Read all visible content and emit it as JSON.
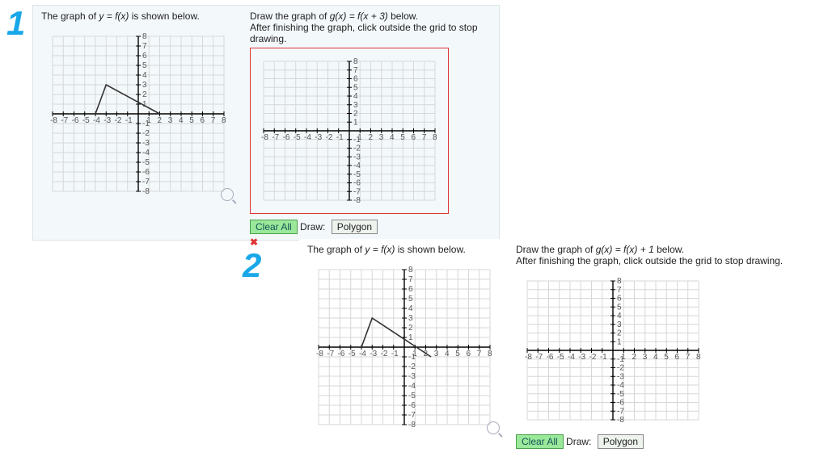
{
  "numbers": {
    "one": "1",
    "two": "2"
  },
  "p1": {
    "left_prompt_pre": "The graph of ",
    "left_prompt_eq": "y = f(x)",
    "left_prompt_post": " is shown below.",
    "right_prompt_pre": "Draw the graph of ",
    "right_prompt_eq": "g(x) = f(x + 3)",
    "right_prompt_post": " below.",
    "right_hint": "After finishing the graph, click outside the grid to stop drawing.",
    "clear": "Clear All",
    "draw_label": "Draw:",
    "draw_tool": "Polygon",
    "close_x": "✖"
  },
  "p2": {
    "left_prompt_pre": "The graph of ",
    "left_prompt_eq": "y = f(x)",
    "left_prompt_post": " is shown below.",
    "right_prompt_pre": "Draw the graph of ",
    "right_prompt_eq": "g(x) = f(x) + 1",
    "right_prompt_post": " below.",
    "right_hint": "After finishing the graph, click outside the grid to stop drawing.",
    "clear": "Clear All",
    "draw_label": "Draw:",
    "draw_tool": "Polygon"
  },
  "chart_data": [
    {
      "type": "line",
      "role": "p1-given",
      "xlim": [
        -8,
        8
      ],
      "ylim": [
        -8,
        8
      ],
      "series": [
        {
          "name": "f(x)",
          "points": [
            [
              -4,
              0
            ],
            [
              -3,
              3
            ],
            [
              2,
              0
            ]
          ]
        }
      ]
    },
    {
      "type": "line",
      "role": "p1-draw-target",
      "xlim": [
        -8,
        8
      ],
      "ylim": [
        -8,
        8
      ],
      "series": [],
      "transform": "f(x+3)"
    },
    {
      "type": "line",
      "role": "p2-given",
      "xlim": [
        -8,
        8
      ],
      "ylim": [
        -8,
        8
      ],
      "series": [
        {
          "name": "f(x)",
          "points": [
            [
              -4,
              0
            ],
            [
              -3,
              3
            ],
            [
              2.5,
              -1
            ]
          ]
        }
      ]
    },
    {
      "type": "line",
      "role": "p2-draw-target",
      "xlim": [
        -8,
        8
      ],
      "ylim": [
        -8,
        8
      ],
      "series": [],
      "transform": "f(x)+1"
    }
  ]
}
